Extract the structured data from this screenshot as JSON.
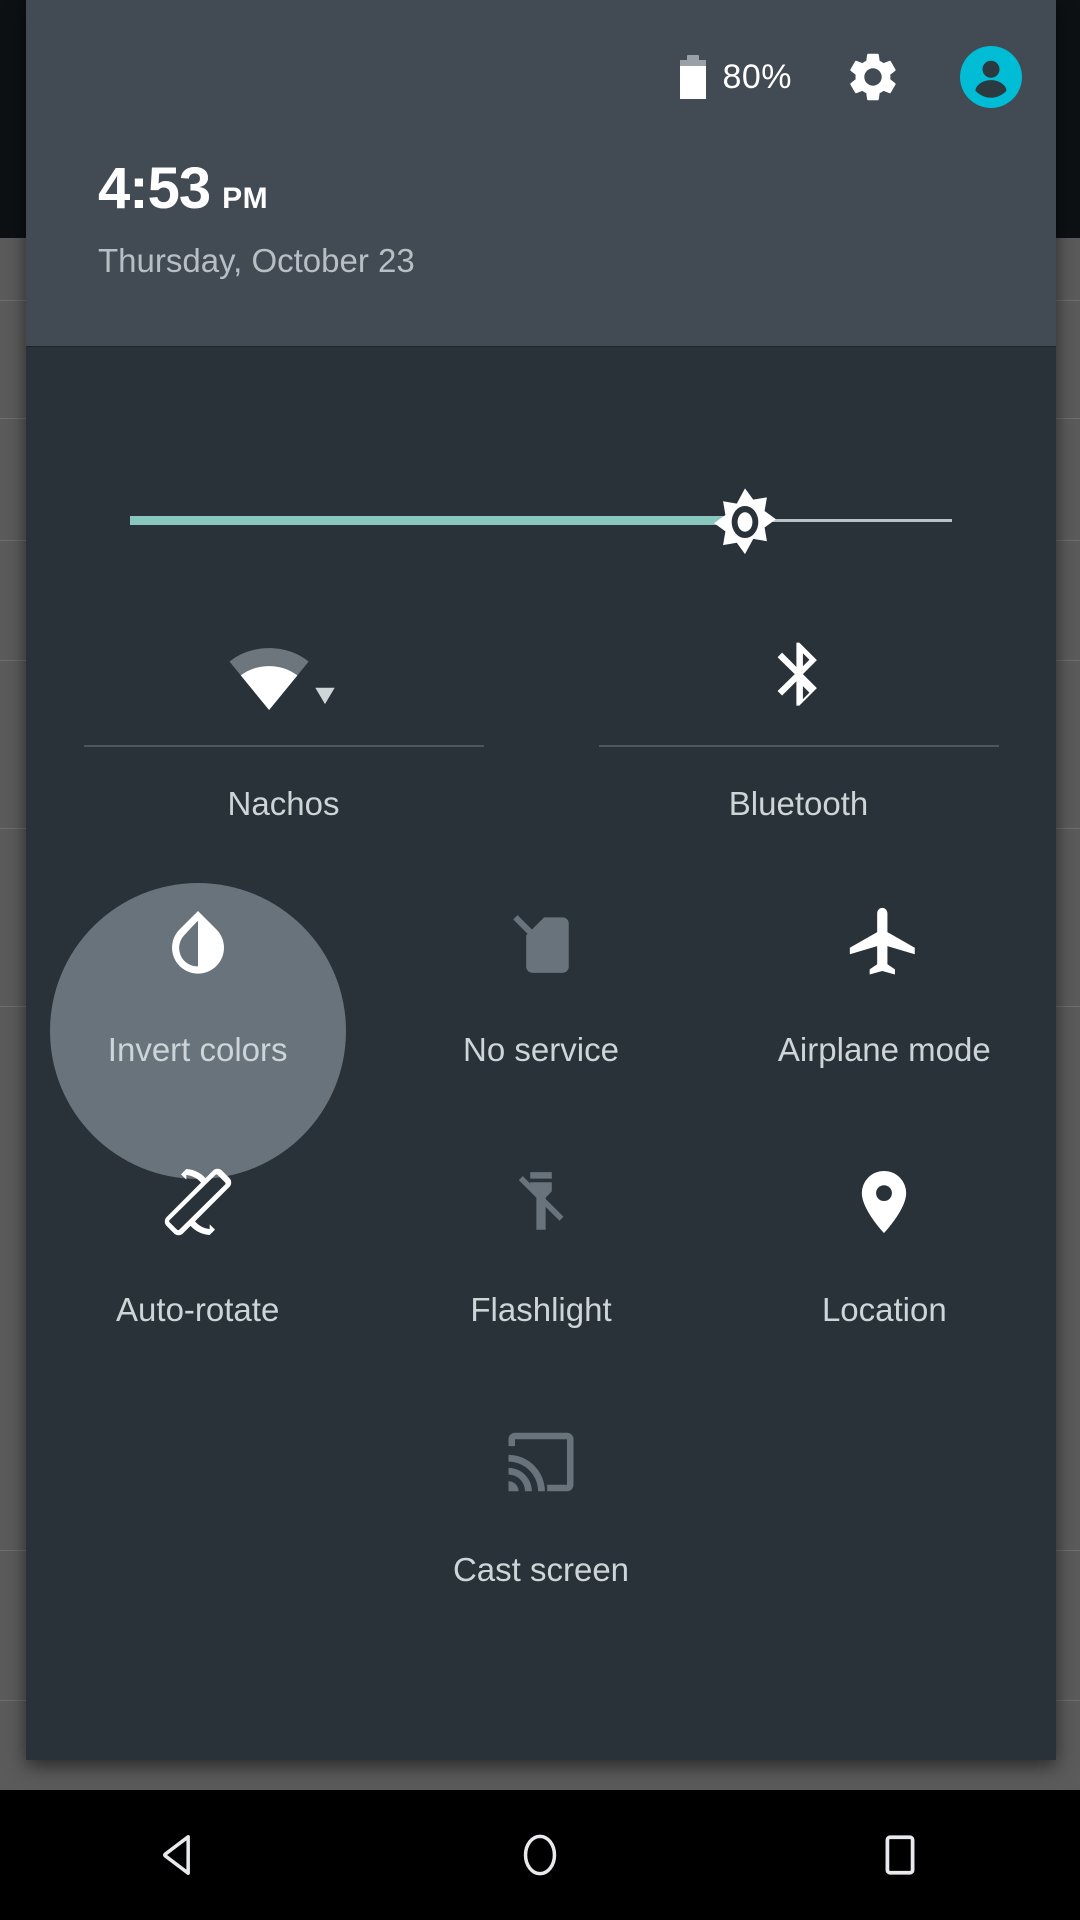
{
  "header": {
    "battery_icon": "battery-icon",
    "battery_percent": "80%",
    "gear_icon": "gear-icon",
    "avatar_icon": "user-avatar-icon",
    "clock_time": "4:53",
    "clock_ampm": "PM",
    "date": "Thursday, October 23",
    "accent_avatar_color": "#00bcd4",
    "header_bg": "#424a53"
  },
  "brightness": {
    "name": "brightness-slider",
    "icon": "brightness-sun-icon",
    "value_percent": 76,
    "fill_color": "#89c6bd",
    "track_color": "#b9c2c7"
  },
  "dual_tiles": [
    {
      "name": "wifi",
      "label": "Nachos",
      "icon": "wifi-icon",
      "state": "on",
      "has_dropdown": true
    },
    {
      "name": "bluetooth",
      "label": "Bluetooth",
      "icon": "bluetooth-icon",
      "state": "on",
      "has_dropdown": false
    }
  ],
  "tiles": [
    {
      "name": "invert-colors",
      "label": "Invert colors",
      "icon": "invert-colors-droplet-icon",
      "state": "on",
      "highlighted": true
    },
    {
      "name": "no-service",
      "label": "No service",
      "icon": "sim-card-off-icon",
      "state": "off",
      "highlighted": false
    },
    {
      "name": "airplane-mode",
      "label": "Airplane mode",
      "icon": "airplane-icon",
      "state": "on",
      "highlighted": false
    },
    {
      "name": "auto-rotate",
      "label": "Auto-rotate",
      "icon": "screen-rotation-icon",
      "state": "on",
      "highlighted": false
    },
    {
      "name": "flashlight",
      "label": "Flashlight",
      "icon": "flashlight-off-icon",
      "state": "off",
      "highlighted": false
    },
    {
      "name": "location",
      "label": "Location",
      "icon": "location-pin-icon",
      "state": "on",
      "highlighted": false
    },
    {
      "name": "cast-screen",
      "label": "Cast screen",
      "icon": "cast-screen-icon",
      "state": "off",
      "highlighted": false
    }
  ],
  "navbar": {
    "back": "back-icon",
    "home": "home-icon",
    "recents": "recents-icon"
  },
  "colors": {
    "panel_bg": "#283238",
    "scrim_bg": "#5b5b5b",
    "icon_on": "#ffffff",
    "icon_off": "#68737b",
    "label": "#ced5d9"
  }
}
